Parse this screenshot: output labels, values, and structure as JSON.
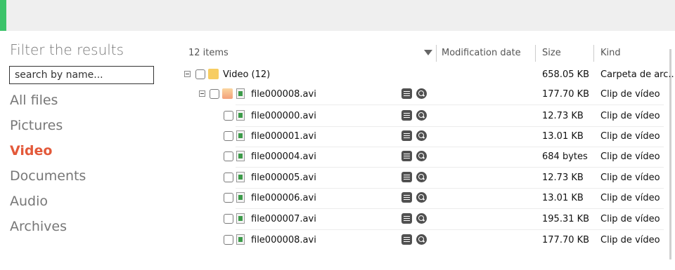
{
  "sidebar": {
    "title": "Filter the results",
    "search_placeholder": "search by name...",
    "categories": [
      "All files",
      "Pictures",
      "Video",
      "Documents",
      "Audio",
      "Archives"
    ],
    "active_category": "Video"
  },
  "list": {
    "item_count": "12 items",
    "columns": {
      "modified": "Modification date",
      "size": "Size",
      "kind": "Kind"
    },
    "rows": [
      {
        "name": "Video (12)",
        "size": "658.05 KB",
        "kind": "Carpeta de arc...",
        "type": "folder"
      },
      {
        "name": "file000008.avi",
        "size": "177.70 KB",
        "kind": "Clip de vídeo",
        "type": "group"
      },
      {
        "name": "file000000.avi",
        "size": "12.73 KB",
        "kind": "Clip de vídeo",
        "type": "file"
      },
      {
        "name": "file000001.avi",
        "size": "13.01 KB",
        "kind": "Clip de vídeo",
        "type": "file"
      },
      {
        "name": "file000004.avi",
        "size": "684 bytes",
        "kind": "Clip de vídeo",
        "type": "file"
      },
      {
        "name": "file000005.avi",
        "size": "12.73 KB",
        "kind": "Clip de vídeo",
        "type": "file"
      },
      {
        "name": "file000006.avi",
        "size": "13.01 KB",
        "kind": "Clip de vídeo",
        "type": "file"
      },
      {
        "name": "file000007.avi",
        "size": "195.31 KB",
        "kind": "Clip de vídeo",
        "type": "file"
      },
      {
        "name": "file000008.avi",
        "size": "177.70 KB",
        "kind": "Clip de vídeo",
        "type": "file"
      }
    ]
  },
  "colors": {
    "accent": "#e3593a",
    "brand_green": "#3cc36a"
  }
}
